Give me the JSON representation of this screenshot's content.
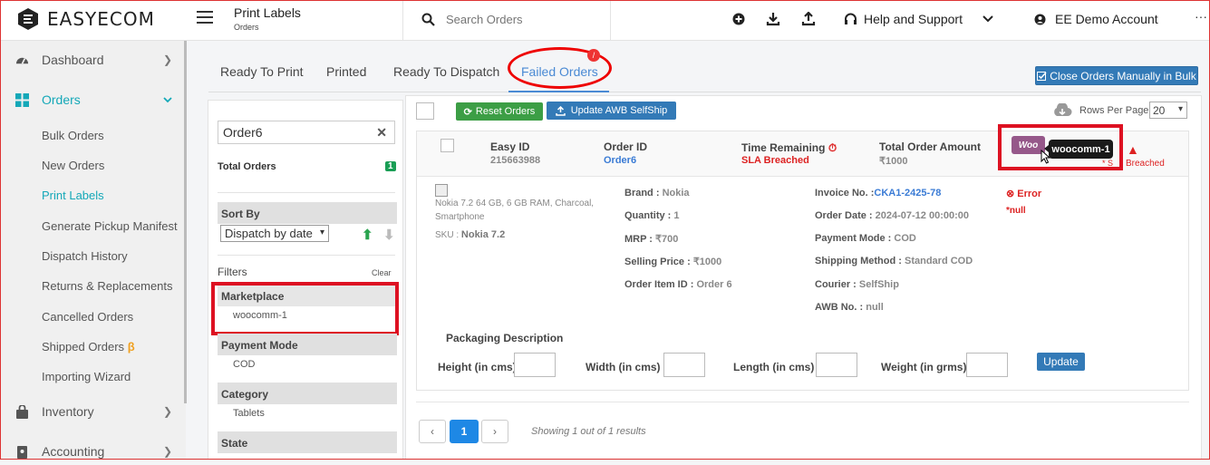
{
  "app": {
    "logo": "EASYECOM"
  },
  "header": {
    "title": "Print Labels",
    "subtitle": "Orders",
    "search_placeholder": "Search Orders",
    "help": "Help and Support",
    "account": "EE Demo Account",
    "more": "···"
  },
  "sidebar": {
    "dashboard": "Dashboard",
    "orders": "Orders",
    "subitems": [
      "Bulk Orders",
      "New Orders",
      "Print Labels",
      "Generate Pickup Manifest",
      "Dispatch History",
      "Returns & Replacements",
      "Cancelled Orders",
      "Shipped Orders",
      "Importing Wizard"
    ],
    "beta": "β",
    "inventory": "Inventory",
    "accounting": "Accounting"
  },
  "tabs": [
    "Ready To Print",
    "Printed",
    "Ready To Dispatch",
    "Failed Orders"
  ],
  "tab_badge": "/",
  "close_bulk_button": "Close Orders Manually in Bulk",
  "filters": {
    "search_value": "Order6",
    "total_label": "Total Orders",
    "total_count": "1",
    "sort_by": "Sort By",
    "sort_value": "Dispatch by date",
    "filters_title": "Filters",
    "clear": "Clear",
    "groups": [
      {
        "title": "Marketplace",
        "value": "woocomm-1"
      },
      {
        "title": "Payment Mode",
        "value": "COD"
      },
      {
        "title": "Category",
        "value": "Tablets"
      },
      {
        "title": "State",
        "value": ""
      }
    ]
  },
  "toolbar": {
    "reset": "Reset Orders",
    "update_awb": "Update AWB SelfShip",
    "rows_label": "Rows Per Page",
    "rows_value": "20"
  },
  "order": {
    "easy_id_label": "Easy ID",
    "easy_id": "215663988",
    "order_id_label": "Order ID",
    "order_id": "Order6",
    "time_label": "Time Remaining",
    "time_value": "SLA Breached",
    "amount_label": "Total Order Amount",
    "amount": "₹1000",
    "marketplace_logo": "Woo",
    "tooltip": "woocomm-1",
    "status_breached": "Breached",
    "status_sla": "* S",
    "product_name": "Nokia 7.2 64 GB, 6 GB RAM, Charcoal, Smartphone",
    "sku_label": "SKU :",
    "sku": "Nokia 7.2",
    "fields_col1": [
      {
        "k": "Brand :",
        "v": "Nokia"
      },
      {
        "k": "Quantity :",
        "v": "1"
      },
      {
        "k": "MRP :",
        "v": "₹700"
      },
      {
        "k": "Selling Price :",
        "v": "₹1000"
      },
      {
        "k": "Order Item ID :",
        "v": "Order 6"
      }
    ],
    "fields_col2": [
      {
        "k": "Invoice No. :",
        "v": "CKA1-2425-78"
      },
      {
        "k": "Order Date :",
        "v": "2024-07-12 00:00:00"
      },
      {
        "k": "Payment Mode :",
        "v": "COD"
      },
      {
        "k": "Shipping Method :",
        "v": "Standard COD"
      },
      {
        "k": "Courier :",
        "v": "SelfShip"
      },
      {
        "k": "AWB No. :",
        "v": "null"
      }
    ],
    "error": "Error",
    "error_detail": "*null",
    "packaging_title": "Packaging Description",
    "height_label": "Height (in cms):",
    "width_label": "Width (in cms) :",
    "length_label": "Length (in cms) :",
    "weight_label": "Weight (in grms):",
    "update_button": "Update"
  },
  "pagination": {
    "prev": "‹",
    "page": "1",
    "next": "›",
    "info": "Showing 1 out of 1 results"
  },
  "colors": {
    "accent": "#4a8ad4",
    "primary": "#337ab7",
    "success": "#3c9e45",
    "danger": "#dd2222",
    "teal": "#14a8b8",
    "woo": "#96588a"
  }
}
